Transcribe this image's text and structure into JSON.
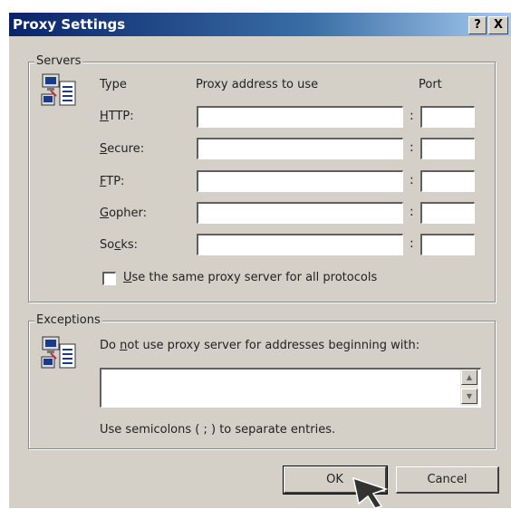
{
  "window": {
    "title": "Proxy Settings",
    "help_glyph": "?",
    "close_glyph": "X"
  },
  "servers": {
    "legend": "Servers",
    "col_type": "Type",
    "col_address": "Proxy address to use",
    "col_port": "Port",
    "rows": [
      {
        "label_pre": "",
        "label_key": "H",
        "label_post": "TTP:",
        "address": "",
        "port": ""
      },
      {
        "label_pre": "",
        "label_key": "S",
        "label_post": "ecure:",
        "address": "",
        "port": ""
      },
      {
        "label_pre": "",
        "label_key": "F",
        "label_post": "TP:",
        "address": "",
        "port": ""
      },
      {
        "label_pre": "",
        "label_key": "G",
        "label_post": "opher:",
        "address": "",
        "port": ""
      },
      {
        "label_pre": "So",
        "label_key": "c",
        "label_post": "ks:",
        "address": "",
        "port": ""
      }
    ],
    "colon": ":",
    "same_proxy_key": "U",
    "same_proxy_rest": "se the same proxy server for all protocols",
    "same_proxy_checked": false
  },
  "exceptions": {
    "legend": "Exceptions",
    "desc_pre": "Do ",
    "desc_key": "n",
    "desc_post": "ot use proxy server for addresses beginning with:",
    "value": "",
    "hint": "Use semicolons ( ; ) to separate entries."
  },
  "buttons": {
    "ok": "OK",
    "cancel": "Cancel"
  },
  "icons": {
    "servers": "network-computer-icon",
    "exceptions": "network-computer-icon",
    "cursor": "mouse-pointer-icon"
  }
}
